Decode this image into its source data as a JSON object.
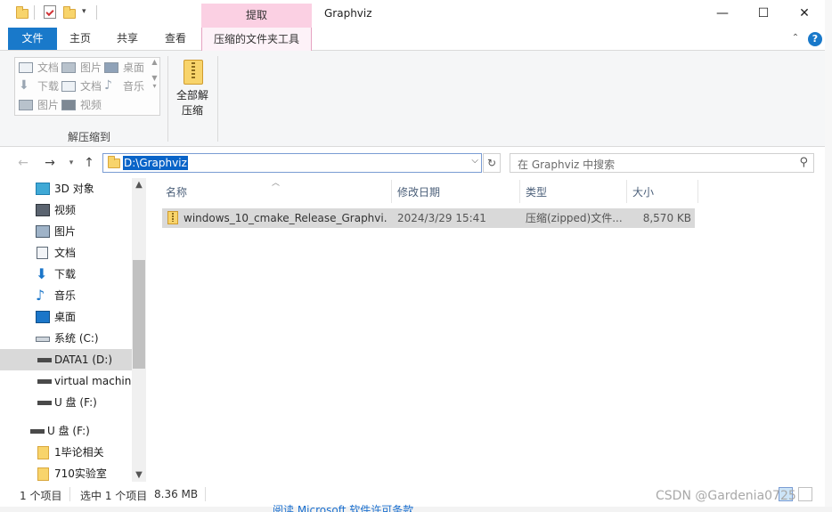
{
  "window": {
    "title": "Graphviz",
    "context_tab_group": "提取",
    "minimize": "—",
    "maximize": "☐",
    "close": "✕"
  },
  "ribbon_tabs": {
    "file": "文件",
    "home": "主页",
    "share": "共享",
    "view": "查看",
    "compressed_tools": "压缩的文件夹工具"
  },
  "ribbon": {
    "destinations": [
      {
        "label": "文档"
      },
      {
        "label": "图片"
      },
      {
        "label": "桌面"
      },
      {
        "label": "下载"
      },
      {
        "label": "文档"
      },
      {
        "label": "音乐"
      },
      {
        "label": "图片"
      },
      {
        "label": "视频"
      }
    ],
    "group_extract_to": "解压缩到",
    "extract_all_line1": "全部解",
    "extract_all_line2": "压缩"
  },
  "address": {
    "path": "D:\\Graphviz",
    "search_placeholder": "在 Graphviz 中搜索"
  },
  "nav": {
    "items": [
      {
        "label": "3D 对象",
        "icon": "3d-objects-icon"
      },
      {
        "label": "视频",
        "icon": "videos-icon"
      },
      {
        "label": "图片",
        "icon": "pictures-icon"
      },
      {
        "label": "文档",
        "icon": "documents-icon"
      },
      {
        "label": "下载",
        "icon": "downloads-icon"
      },
      {
        "label": "音乐",
        "icon": "music-icon"
      },
      {
        "label": "桌面",
        "icon": "desktop-icon"
      },
      {
        "label": "系统 (C:)",
        "icon": "system-drive-icon"
      },
      {
        "label": "DATA1 (D:)",
        "icon": "drive-icon"
      },
      {
        "label": "virtual machine",
        "icon": "drive-icon"
      },
      {
        "label": "U 盘 (F:)",
        "icon": "usb-drive-icon"
      },
      {
        "label": "U 盘 (F:)",
        "icon": "usb-drive-icon"
      },
      {
        "label": "1毕论相关",
        "icon": "folder-icon"
      },
      {
        "label": "710实验室",
        "icon": "folder-icon"
      }
    ]
  },
  "filelist": {
    "columns": {
      "name": "名称",
      "modified": "修改日期",
      "type": "类型",
      "size": "大小"
    },
    "rows": [
      {
        "name": "windows_10_cmake_Release_Graphvi...",
        "modified": "2024/3/29 15:41",
        "type": "压缩(zipped)文件...",
        "size": "8,570 KB"
      }
    ]
  },
  "status": {
    "count": "1 个项目",
    "selected": "选中 1 个项目",
    "size": "8.36 MB"
  },
  "background": {
    "watermark": "CSDN @Gardenia0725",
    "link_text": "阅读 Microsoft 软件许可条款"
  },
  "colors": {
    "accent": "#1979ca",
    "context_tab": "#fbd0e3",
    "selection": "#d9d9d9"
  }
}
